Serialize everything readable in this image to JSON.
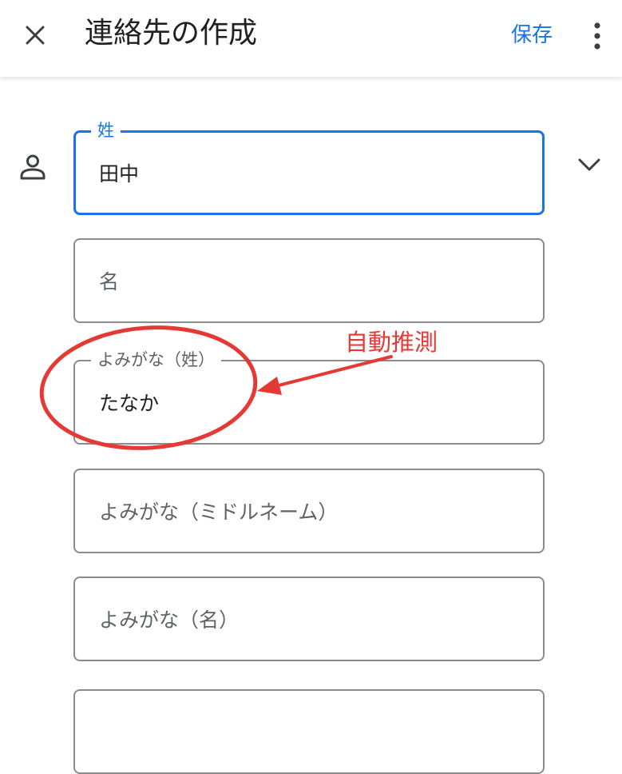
{
  "colors": {
    "accent": "#1a73e8",
    "annotation": "#e53935",
    "border": "#8c8c8c",
    "text_secondary": "#5f6368"
  },
  "header": {
    "close_icon": "close-icon",
    "title": "連絡先の作成",
    "save_label": "保存",
    "more_icon": "more-vert-icon"
  },
  "form": {
    "person_icon": "person-icon",
    "expand_icon": "chevron-down-icon",
    "last_name": {
      "label": "姓",
      "value": "田中"
    },
    "first_name": {
      "placeholder": "名"
    },
    "phonetic_last": {
      "label": "よみがな（姓）",
      "value": "たなか"
    },
    "phonetic_middle": {
      "placeholder": "よみがな（ミドルネーム）"
    },
    "phonetic_first": {
      "placeholder": "よみがな（名）"
    }
  },
  "annotation": {
    "text": "自動推測"
  }
}
